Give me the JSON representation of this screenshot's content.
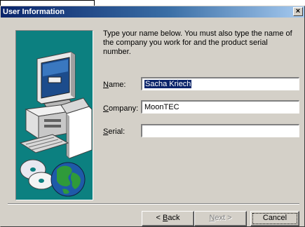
{
  "window": {
    "title": "User Information",
    "close_glyph": "×"
  },
  "instructions": "Type your name below. You must also type the name of the company you work for and the product serial number.",
  "form": {
    "name": {
      "label_hot": "N",
      "label_rest": "ame:",
      "value": "Sacha Kriech"
    },
    "company": {
      "label_hot": "C",
      "label_rest": "ompany:",
      "value": "MoonTEC"
    },
    "serial": {
      "label_hot": "S",
      "label_rest": "erial:",
      "value": ""
    }
  },
  "buttons": {
    "back": {
      "prefix": "< ",
      "hot": "B",
      "rest": "ack"
    },
    "next": {
      "hot": "N",
      "rest": "ext >"
    },
    "cancel": {
      "label": "Cancel"
    }
  },
  "icons": {
    "illustration": "computer-with-cds-and-globe-icon",
    "close": "close-icon"
  },
  "colors": {
    "title_gradient_start": "#0a246a",
    "title_gradient_end": "#a6caf0",
    "panel_teal": "#0c8080",
    "dialog_face": "#d4d0c8",
    "selection": "#0a246a"
  }
}
